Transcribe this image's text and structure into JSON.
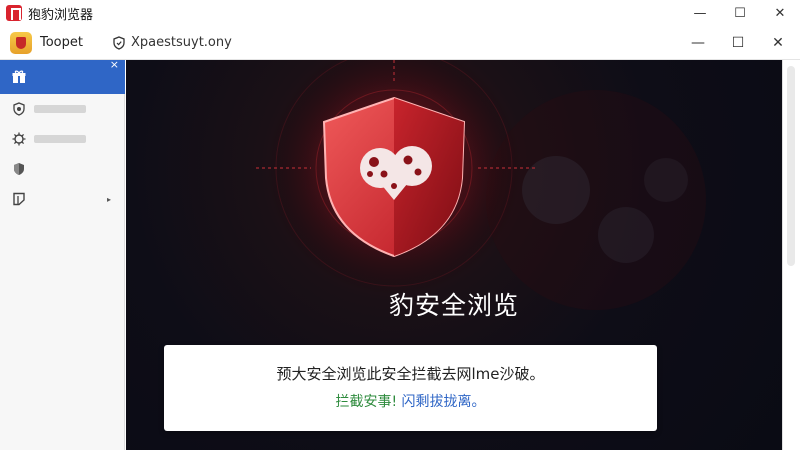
{
  "window": {
    "title": "狍豹浏览器",
    "controls": {
      "minimize": "—",
      "maximize": "☐",
      "close": "✕"
    }
  },
  "tab": {
    "label": "Toopet",
    "url": "Xpaestsuyt.ony",
    "controls": {
      "minimize": "—",
      "maximize": "☐",
      "close": "✕"
    }
  },
  "sidebar": {
    "close": "×",
    "items": [
      {
        "icon": "gift-icon"
      },
      {
        "icon": "shield-icon"
      },
      {
        "icon": "gear-icon"
      },
      {
        "icon": "shield-check-icon"
      },
      {
        "icon": "bookmark-icon",
        "arrow": "▸"
      }
    ]
  },
  "main": {
    "title": "豹安全浏览",
    "alert": {
      "line1": "预大安全浏览此安全拦截去网lme沙破。",
      "line2_green": "拦截安事!",
      "line2_blue": "闪剩拔拢离。"
    }
  },
  "colors": {
    "accent_blue": "#2f66c6",
    "shield_red": "#d9232e",
    "alert_green": "#2e8b3d",
    "background_dark": "#0a0b14"
  }
}
